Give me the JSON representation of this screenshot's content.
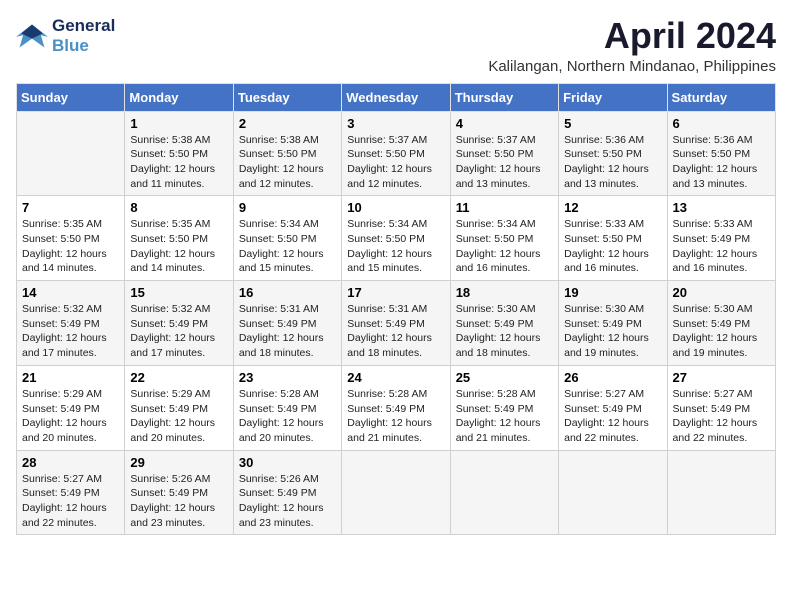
{
  "header": {
    "logo_line1": "General",
    "logo_line2": "Blue",
    "month": "April 2024",
    "location": "Kalilangan, Northern Mindanao, Philippines"
  },
  "columns": [
    "Sunday",
    "Monday",
    "Tuesday",
    "Wednesday",
    "Thursday",
    "Friday",
    "Saturday"
  ],
  "weeks": [
    [
      {
        "day": "",
        "info": ""
      },
      {
        "day": "1",
        "info": "Sunrise: 5:38 AM\nSunset: 5:50 PM\nDaylight: 12 hours\nand 11 minutes."
      },
      {
        "day": "2",
        "info": "Sunrise: 5:38 AM\nSunset: 5:50 PM\nDaylight: 12 hours\nand 12 minutes."
      },
      {
        "day": "3",
        "info": "Sunrise: 5:37 AM\nSunset: 5:50 PM\nDaylight: 12 hours\nand 12 minutes."
      },
      {
        "day": "4",
        "info": "Sunrise: 5:37 AM\nSunset: 5:50 PM\nDaylight: 12 hours\nand 13 minutes."
      },
      {
        "day": "5",
        "info": "Sunrise: 5:36 AM\nSunset: 5:50 PM\nDaylight: 12 hours\nand 13 minutes."
      },
      {
        "day": "6",
        "info": "Sunrise: 5:36 AM\nSunset: 5:50 PM\nDaylight: 12 hours\nand 13 minutes."
      }
    ],
    [
      {
        "day": "7",
        "info": "Sunrise: 5:35 AM\nSunset: 5:50 PM\nDaylight: 12 hours\nand 14 minutes."
      },
      {
        "day": "8",
        "info": "Sunrise: 5:35 AM\nSunset: 5:50 PM\nDaylight: 12 hours\nand 14 minutes."
      },
      {
        "day": "9",
        "info": "Sunrise: 5:34 AM\nSunset: 5:50 PM\nDaylight: 12 hours\nand 15 minutes."
      },
      {
        "day": "10",
        "info": "Sunrise: 5:34 AM\nSunset: 5:50 PM\nDaylight: 12 hours\nand 15 minutes."
      },
      {
        "day": "11",
        "info": "Sunrise: 5:34 AM\nSunset: 5:50 PM\nDaylight: 12 hours\nand 16 minutes."
      },
      {
        "day": "12",
        "info": "Sunrise: 5:33 AM\nSunset: 5:50 PM\nDaylight: 12 hours\nand 16 minutes."
      },
      {
        "day": "13",
        "info": "Sunrise: 5:33 AM\nSunset: 5:49 PM\nDaylight: 12 hours\nand 16 minutes."
      }
    ],
    [
      {
        "day": "14",
        "info": "Sunrise: 5:32 AM\nSunset: 5:49 PM\nDaylight: 12 hours\nand 17 minutes."
      },
      {
        "day": "15",
        "info": "Sunrise: 5:32 AM\nSunset: 5:49 PM\nDaylight: 12 hours\nand 17 minutes."
      },
      {
        "day": "16",
        "info": "Sunrise: 5:31 AM\nSunset: 5:49 PM\nDaylight: 12 hours\nand 18 minutes."
      },
      {
        "day": "17",
        "info": "Sunrise: 5:31 AM\nSunset: 5:49 PM\nDaylight: 12 hours\nand 18 minutes."
      },
      {
        "day": "18",
        "info": "Sunrise: 5:30 AM\nSunset: 5:49 PM\nDaylight: 12 hours\nand 18 minutes."
      },
      {
        "day": "19",
        "info": "Sunrise: 5:30 AM\nSunset: 5:49 PM\nDaylight: 12 hours\nand 19 minutes."
      },
      {
        "day": "20",
        "info": "Sunrise: 5:30 AM\nSunset: 5:49 PM\nDaylight: 12 hours\nand 19 minutes."
      }
    ],
    [
      {
        "day": "21",
        "info": "Sunrise: 5:29 AM\nSunset: 5:49 PM\nDaylight: 12 hours\nand 20 minutes."
      },
      {
        "day": "22",
        "info": "Sunrise: 5:29 AM\nSunset: 5:49 PM\nDaylight: 12 hours\nand 20 minutes."
      },
      {
        "day": "23",
        "info": "Sunrise: 5:28 AM\nSunset: 5:49 PM\nDaylight: 12 hours\nand 20 minutes."
      },
      {
        "day": "24",
        "info": "Sunrise: 5:28 AM\nSunset: 5:49 PM\nDaylight: 12 hours\nand 21 minutes."
      },
      {
        "day": "25",
        "info": "Sunrise: 5:28 AM\nSunset: 5:49 PM\nDaylight: 12 hours\nand 21 minutes."
      },
      {
        "day": "26",
        "info": "Sunrise: 5:27 AM\nSunset: 5:49 PM\nDaylight: 12 hours\nand 22 minutes."
      },
      {
        "day": "27",
        "info": "Sunrise: 5:27 AM\nSunset: 5:49 PM\nDaylight: 12 hours\nand 22 minutes."
      }
    ],
    [
      {
        "day": "28",
        "info": "Sunrise: 5:27 AM\nSunset: 5:49 PM\nDaylight: 12 hours\nand 22 minutes."
      },
      {
        "day": "29",
        "info": "Sunrise: 5:26 AM\nSunset: 5:49 PM\nDaylight: 12 hours\nand 23 minutes."
      },
      {
        "day": "30",
        "info": "Sunrise: 5:26 AM\nSunset: 5:49 PM\nDaylight: 12 hours\nand 23 minutes."
      },
      {
        "day": "",
        "info": ""
      },
      {
        "day": "",
        "info": ""
      },
      {
        "day": "",
        "info": ""
      },
      {
        "day": "",
        "info": ""
      }
    ]
  ]
}
